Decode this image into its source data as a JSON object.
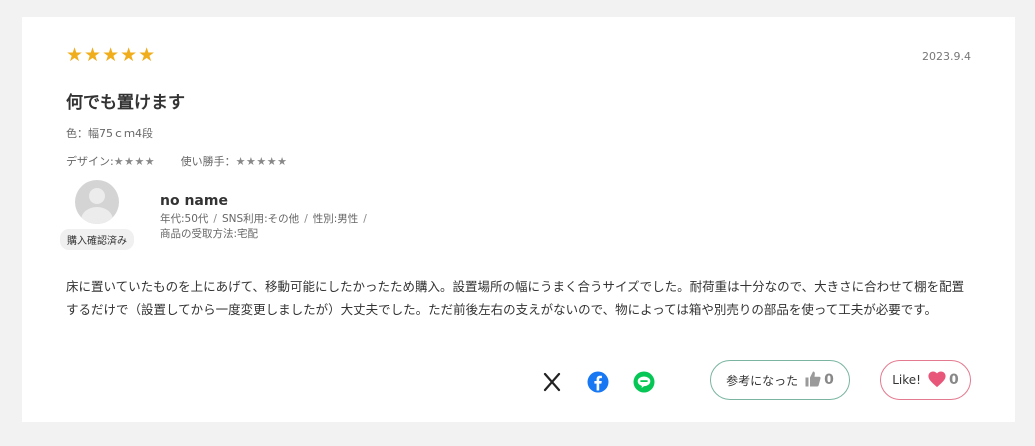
{
  "review": {
    "stars": "★★★★★",
    "rating": 5,
    "date": "2023.9.4",
    "title": "何でも置けます",
    "color_line": "色：幅75ｃｍ4段",
    "design_label": "デザイン:",
    "design_stars": "★★★★",
    "usability_label": "使い勝手：",
    "usability_stars": "★★★★★",
    "body": "床に置いていたものを上にあげて、移動可能にしたかったため購入。設置場所の幅にうまく合うサイズでした。耐荷重は十分なので、大きさに合わせて棚を配置するだけで（設置してから一度変更しましたが）大丈夫でした。ただ前後左右の支えがないので、物によっては箱や別売りの部品を使って工夫が必要です。"
  },
  "user": {
    "name": "no name",
    "verified": "購入確認済み",
    "age": "年代:50代",
    "sns": "SNS利用:その他",
    "gender": "性別:男性",
    "receive": "商品の受取方法:宅配",
    "separator": "/"
  },
  "actions": {
    "helpful_label": "参考になった",
    "helpful_count": "0",
    "like_label": "Like!",
    "like_count": "0"
  },
  "colors": {
    "star": "#f0ad1c",
    "helpful_border": "#7bb5a2",
    "like_border": "#e47a8f",
    "heart": "#e8577a",
    "facebook": "#1877f2",
    "line": "#06c755"
  }
}
